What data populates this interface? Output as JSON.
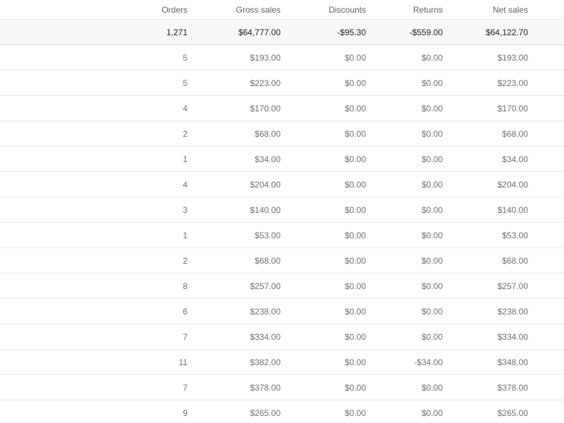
{
  "table": {
    "columns": {
      "orders": "Orders",
      "gross": "Gross sales",
      "discounts": "Discounts",
      "returns": "Returns",
      "net": "Net sales"
    },
    "totals": {
      "orders": "1,271",
      "gross": "$64,777.00",
      "discounts": "-$95.30",
      "returns": "-$559.00",
      "net": "$64,122.70"
    },
    "rows": [
      {
        "orders": "5",
        "gross": "$193.00",
        "discounts": "$0.00",
        "returns": "$0.00",
        "net": "$193.00"
      },
      {
        "orders": "5",
        "gross": "$223.00",
        "discounts": "$0.00",
        "returns": "$0.00",
        "net": "$223.00"
      },
      {
        "orders": "4",
        "gross": "$170.00",
        "discounts": "$0.00",
        "returns": "$0.00",
        "net": "$170.00"
      },
      {
        "orders": "2",
        "gross": "$68.00",
        "discounts": "$0.00",
        "returns": "$0.00",
        "net": "$68.00"
      },
      {
        "orders": "1",
        "gross": "$34.00",
        "discounts": "$0.00",
        "returns": "$0.00",
        "net": "$34.00"
      },
      {
        "orders": "4",
        "gross": "$204.00",
        "discounts": "$0.00",
        "returns": "$0.00",
        "net": "$204.00"
      },
      {
        "orders": "3",
        "gross": "$140.00",
        "discounts": "$0.00",
        "returns": "$0.00",
        "net": "$140.00"
      },
      {
        "orders": "1",
        "gross": "$53.00",
        "discounts": "$0.00",
        "returns": "$0.00",
        "net": "$53.00"
      },
      {
        "orders": "2",
        "gross": "$68.00",
        "discounts": "$0.00",
        "returns": "$0.00",
        "net": "$68.00"
      },
      {
        "orders": "8",
        "gross": "$257.00",
        "discounts": "$0.00",
        "returns": "$0.00",
        "net": "$257.00"
      },
      {
        "orders": "6",
        "gross": "$238.00",
        "discounts": "$0.00",
        "returns": "$0.00",
        "net": "$238.00"
      },
      {
        "orders": "7",
        "gross": "$334.00",
        "discounts": "$0.00",
        "returns": "$0.00",
        "net": "$334.00"
      },
      {
        "orders": "11",
        "gross": "$382.00",
        "discounts": "$0.00",
        "returns": "-$34.00",
        "net": "$348.00"
      },
      {
        "orders": "7",
        "gross": "$378.00",
        "discounts": "$0.00",
        "returns": "$0.00",
        "net": "$378.00"
      },
      {
        "orders": "9",
        "gross": "$265.00",
        "discounts": "$0.00",
        "returns": "$0.00",
        "net": "$265.00"
      }
    ]
  }
}
